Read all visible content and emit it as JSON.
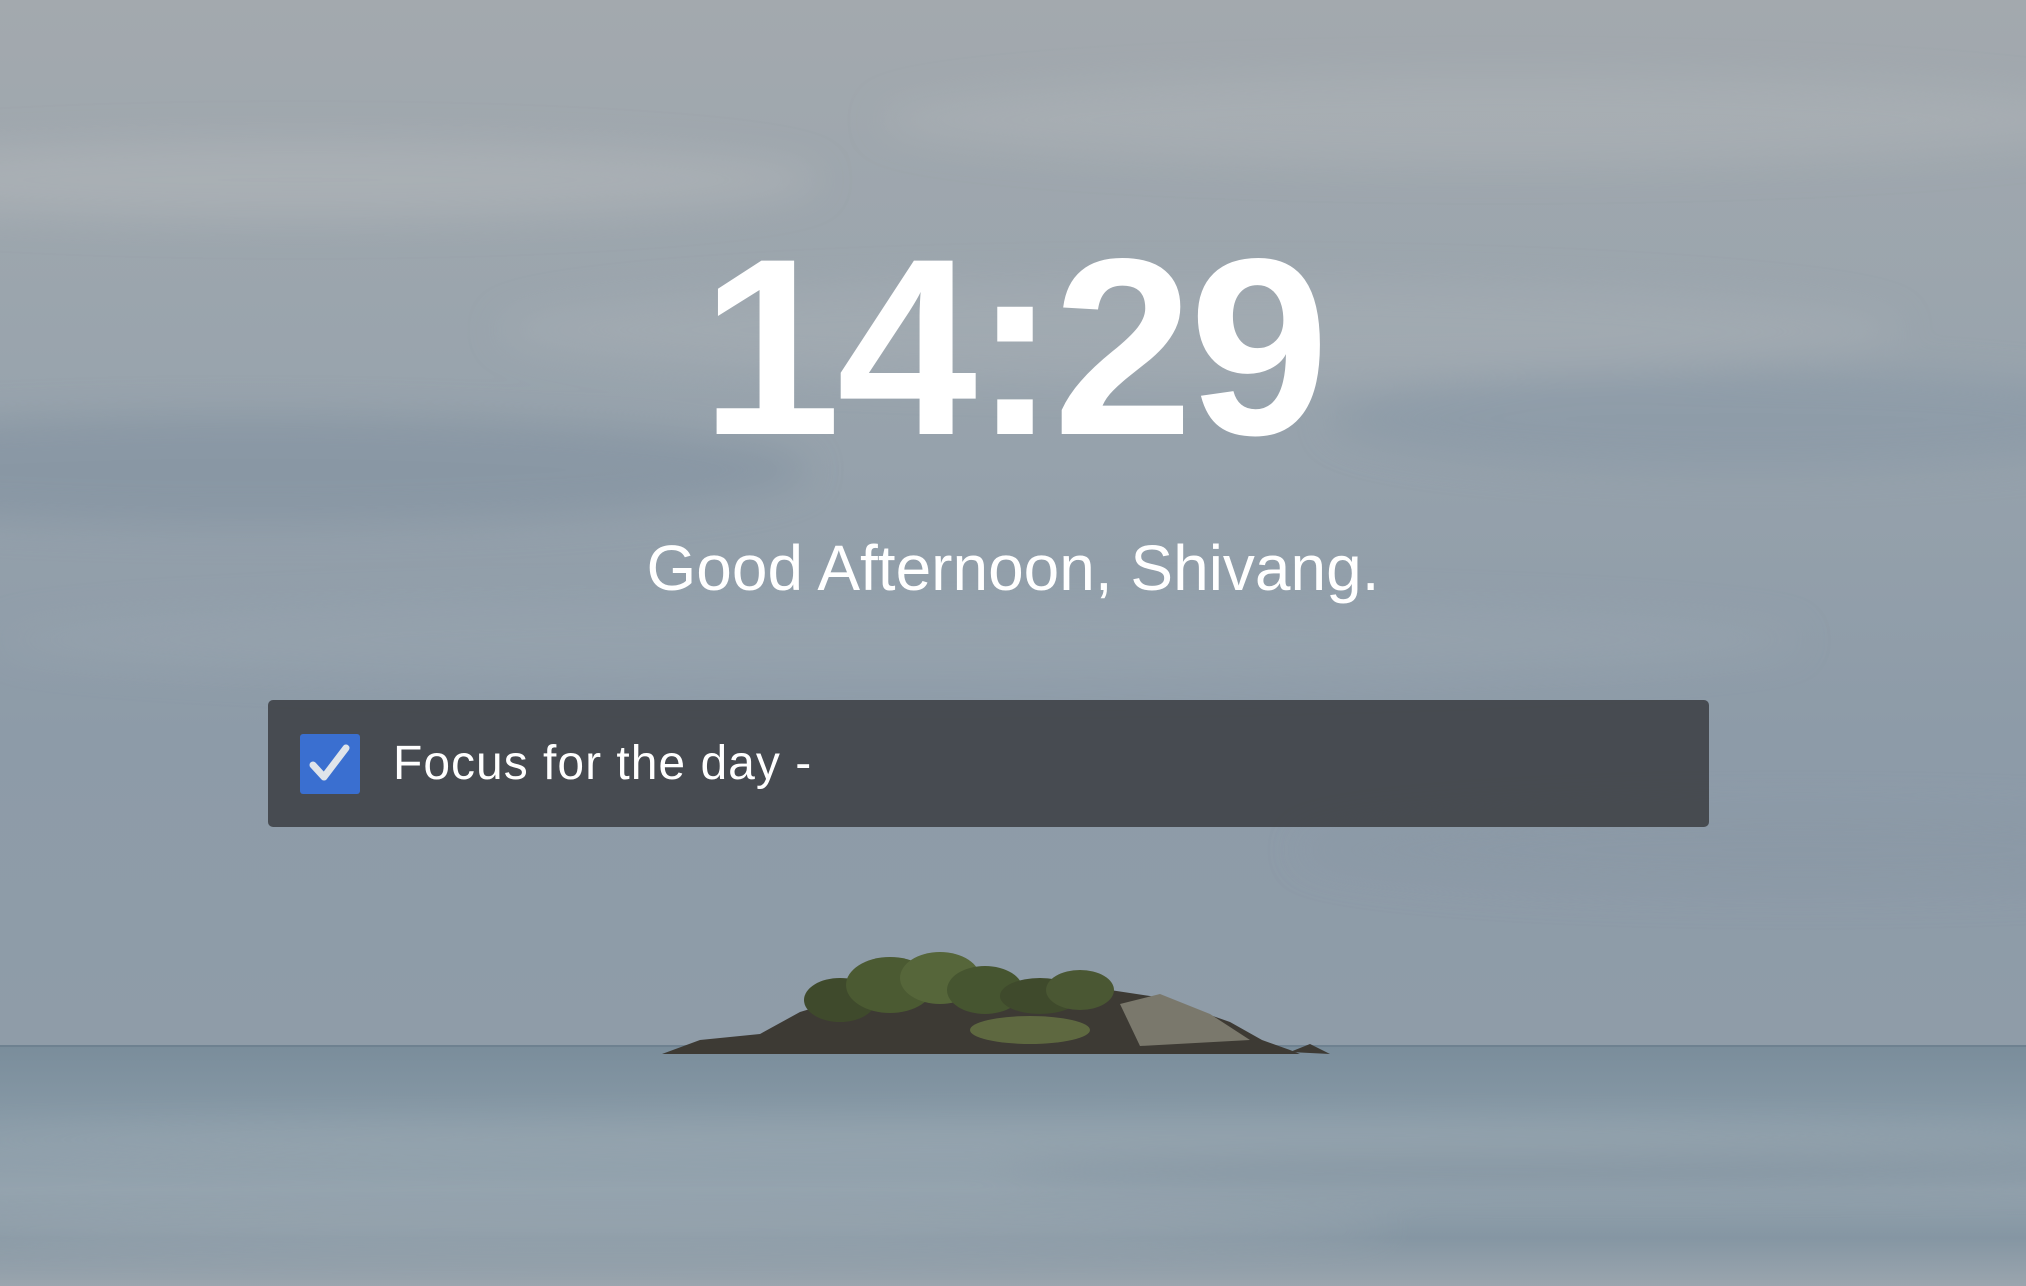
{
  "clock": {
    "time": "14:29"
  },
  "greeting": {
    "text": "Good Afternoon, Shivang."
  },
  "focus": {
    "label": "Focus for the day -",
    "checked": true,
    "checkbox_icon": "checkmark-icon",
    "accent_color": "#3a6fd0"
  },
  "background": {
    "scene": "island-seascape",
    "sky_color": "#96a2ad",
    "sea_color": "#7e909e"
  }
}
